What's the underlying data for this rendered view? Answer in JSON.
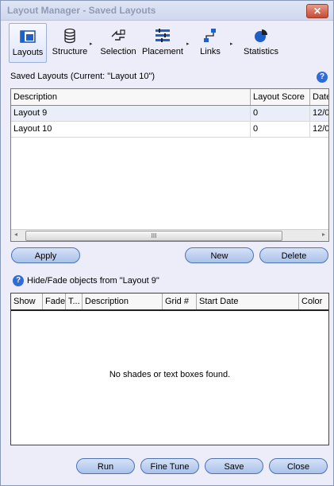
{
  "window": {
    "title": "Layout Manager - Saved Layouts",
    "close_glyph": "✕"
  },
  "toolbar": {
    "items": [
      {
        "label": "Layouts",
        "icon": "layouts-icon"
      },
      {
        "label": "Structure",
        "icon": "database-icon"
      },
      {
        "label": "Selection",
        "icon": "selection-icon"
      },
      {
        "label": "Placement",
        "icon": "placement-icon"
      },
      {
        "label": "Links",
        "icon": "links-icon"
      },
      {
        "label": "Statistics",
        "icon": "pie-chart-icon"
      }
    ],
    "active": "Layouts",
    "arrow": "▸"
  },
  "saved_layouts": {
    "label": "Saved Layouts (Current: \"Layout 10\")",
    "help": "?",
    "columns": [
      "Description",
      "Layout Score",
      "Date"
    ],
    "rows": [
      [
        "Layout 9",
        "0",
        "12/0"
      ],
      [
        "Layout 10",
        "0",
        "12/0"
      ]
    ],
    "scroll_left": "◂",
    "scroll_right": "▸",
    "scroll_grip": "III"
  },
  "buttons": {
    "apply": "Apply",
    "new": "New",
    "delete": "Delete",
    "run": "Run",
    "fine_tune": "Fine Tune",
    "save": "Save",
    "close": "Close"
  },
  "hide_fade": {
    "label": "Hide/Fade objects from \"Layout 9\"",
    "help": "?",
    "columns": [
      "Show",
      "Fade",
      "T...",
      "Description",
      "Grid #",
      "Start Date",
      "Color"
    ],
    "empty_message": "No shades or text boxes found."
  },
  "colors": {
    "accent": "#2f6cd8",
    "button": "#a9c1ea",
    "background": "#ecedf9"
  }
}
